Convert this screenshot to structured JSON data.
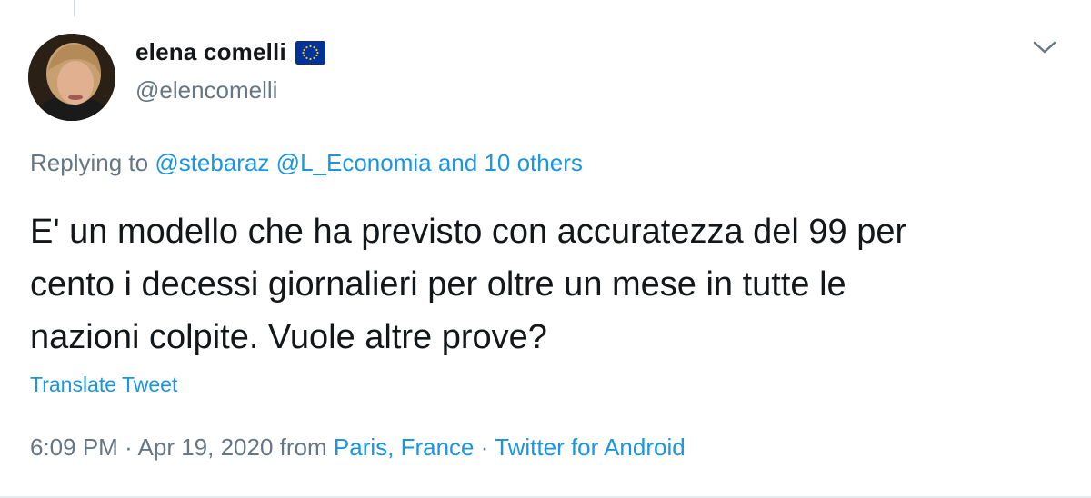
{
  "author": {
    "display_name": "elena comelli",
    "handle": "@elencomelli",
    "badge_icon": "eu-flag-icon"
  },
  "reply": {
    "prefix": "Replying to",
    "mention_1": "@stebaraz",
    "mention_2": "@L_Economia",
    "suffix": "and 10 others"
  },
  "tweet": {
    "line_1": "E' un modello che ha previsto con accuratezza del 99 per",
    "line_2": "cento i decessi giornalieri per oltre un mese in tutte le",
    "line_3": "nazioni colpite. Vuole altre prove?"
  },
  "translate_label": "Translate Tweet",
  "meta": {
    "time": "6:09 PM",
    "date": "Apr 19, 2020",
    "from_label": "from",
    "location": "Paris, France",
    "separator": "·",
    "client": "Twitter for Android"
  },
  "colors": {
    "link": "#1b95e0",
    "secondary_text": "#657786",
    "primary_text": "#14171a",
    "eu_blue": "#003399",
    "eu_gold": "#ffcc00"
  }
}
